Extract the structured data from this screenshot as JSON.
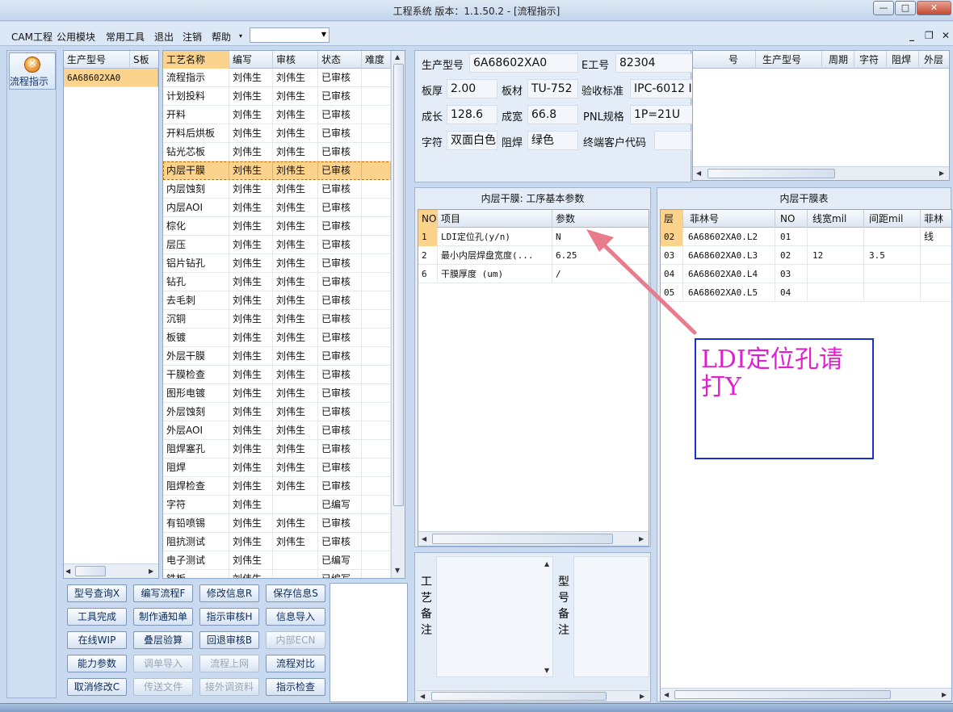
{
  "window": {
    "title": "工程系统 版本：1.1.50.2 - [流程指示]",
    "min": "—",
    "max": "□",
    "close": "✕"
  },
  "menu": {
    "items": [
      "CAM工程",
      "公用模块",
      "常用工具",
      "退出",
      "注销",
      "帮助"
    ],
    "combo_value": "",
    "mdi_min": "_",
    "mdi_restore": "❐",
    "mdi_close": "✕"
  },
  "nav": {
    "flow_label": "流程指示",
    "flow_icon": "Ⓜ"
  },
  "model_list": {
    "headers": [
      "生产型号",
      "S板"
    ],
    "rows": [
      [
        "6A68602XA0",
        ""
      ]
    ]
  },
  "process_grid": {
    "headers": [
      "工艺名称",
      "编写",
      "审核",
      "状态",
      "难度"
    ],
    "rows": [
      [
        "流程指示",
        "刘伟生",
        "刘伟生",
        "已审核",
        ""
      ],
      [
        "计划投料",
        "刘伟生",
        "刘伟生",
        "已审核",
        ""
      ],
      [
        "开料",
        "刘伟生",
        "刘伟生",
        "已审核",
        ""
      ],
      [
        "开料后烘板",
        "刘伟生",
        "刘伟生",
        "已审核",
        ""
      ],
      [
        "钻光芯板",
        "刘伟生",
        "刘伟生",
        "已审核",
        ""
      ],
      [
        "内层干膜",
        "刘伟生",
        "刘伟生",
        "已审核",
        ""
      ],
      [
        "内层蚀刻",
        "刘伟生",
        "刘伟生",
        "已审核",
        ""
      ],
      [
        "内层AOI",
        "刘伟生",
        "刘伟生",
        "已审核",
        ""
      ],
      [
        "棕化",
        "刘伟生",
        "刘伟生",
        "已审核",
        ""
      ],
      [
        "层压",
        "刘伟生",
        "刘伟生",
        "已审核",
        ""
      ],
      [
        "铝片钻孔",
        "刘伟生",
        "刘伟生",
        "已审核",
        ""
      ],
      [
        "钻孔",
        "刘伟生",
        "刘伟生",
        "已审核",
        ""
      ],
      [
        "去毛刺",
        "刘伟生",
        "刘伟生",
        "已审核",
        ""
      ],
      [
        "沉铜",
        "刘伟生",
        "刘伟生",
        "已审核",
        ""
      ],
      [
        "板镀",
        "刘伟生",
        "刘伟生",
        "已审核",
        ""
      ],
      [
        "外层干膜",
        "刘伟生",
        "刘伟生",
        "已审核",
        ""
      ],
      [
        "干膜检查",
        "刘伟生",
        "刘伟生",
        "已审核",
        ""
      ],
      [
        "图形电镀",
        "刘伟生",
        "刘伟生",
        "已审核",
        ""
      ],
      [
        "外层蚀刻",
        "刘伟生",
        "刘伟生",
        "已审核",
        ""
      ],
      [
        "外层AOI",
        "刘伟生",
        "刘伟生",
        "已审核",
        ""
      ],
      [
        "阻焊塞孔",
        "刘伟生",
        "刘伟生",
        "已审核",
        ""
      ],
      [
        "阻焊",
        "刘伟生",
        "刘伟生",
        "已审核",
        ""
      ],
      [
        "阻焊检查",
        "刘伟生",
        "刘伟生",
        "已审核",
        ""
      ],
      [
        "字符",
        "刘伟生",
        "",
        "已编写",
        ""
      ],
      [
        "有铅喷锡",
        "刘伟生",
        "刘伟生",
        "已审核",
        ""
      ],
      [
        "阻抗测试",
        "刘伟生",
        "刘伟生",
        "已审核",
        ""
      ],
      [
        "电子测试",
        "刘伟生",
        "",
        "已编写",
        ""
      ],
      [
        "铣板",
        "刘伟生",
        "",
        "已编写",
        ""
      ]
    ]
  },
  "buttons": [
    [
      "型号查询X",
      "编写流程F",
      "修改信息R",
      "保存信息S"
    ],
    [
      "工具完成",
      "制作通知单",
      "指示审核H",
      "信息导入"
    ],
    [
      "在线WIP",
      "叠层验算",
      "回退审核B",
      "内部ECN"
    ],
    [
      "能力参数",
      "调单导入",
      "流程上网",
      "流程对比"
    ],
    [
      "取消修改C",
      "传送文件",
      "接外调资料",
      "指示检查"
    ]
  ],
  "info": {
    "model_label": "生产型号",
    "model_value": "6A68602XA0",
    "eno_label": "E工号",
    "eno_value": "82304",
    "thick_label": "板厚",
    "thick_value": "2.00",
    "mat_label": "板材",
    "mat_value": "TU-752",
    "std_label": "验收标准",
    "std_value": "IPC-6012 I",
    "len_label": "成长",
    "len_value": "128.6",
    "wid_label": "成宽",
    "wid_value": "66.8",
    "pnl_label": "PNL规格",
    "pnl_value": "1P=21U",
    "char_label": "字符",
    "char_value": "双面白色",
    "mask_label": "阻焊",
    "mask_value": "绿色",
    "cust_label": "终端客户代码",
    "cust_value": ""
  },
  "side_grid": {
    "headers": [
      "号",
      "生产型号",
      "周期",
      "字符",
      "阻焊",
      "外层"
    ]
  },
  "params": {
    "title": "内层干膜: 工序基本参数",
    "headers": [
      "NO",
      "项目",
      "参数"
    ],
    "rows": [
      [
        "1",
        "LDI定位孔(y/n)",
        "N"
      ],
      [
        "2",
        "最小内层焊盘宽度(...",
        "6.25"
      ],
      [
        "6",
        "干膜厚度 (um)",
        "/"
      ]
    ]
  },
  "film": {
    "title": "内层干膜表",
    "headers": [
      "层",
      "菲林号",
      "NO",
      "线宽mil",
      "间距mil",
      "菲林线"
    ],
    "rows": [
      [
        "02",
        "6A68602XA0.L2",
        "01",
        "",
        ""
      ],
      [
        "03",
        "6A68602XA0.L3",
        "02",
        "12",
        "3.5"
      ],
      [
        "04",
        "6A68602XA0.L4",
        "03",
        "",
        ""
      ],
      [
        "05",
        "6A68602XA0.L5",
        "04",
        "",
        ""
      ]
    ]
  },
  "notes": {
    "process_label": "工艺备注",
    "model_label": "型号备注"
  },
  "annotation": {
    "text": "LDI定位孔请打Y",
    "color": "#e020d0"
  }
}
